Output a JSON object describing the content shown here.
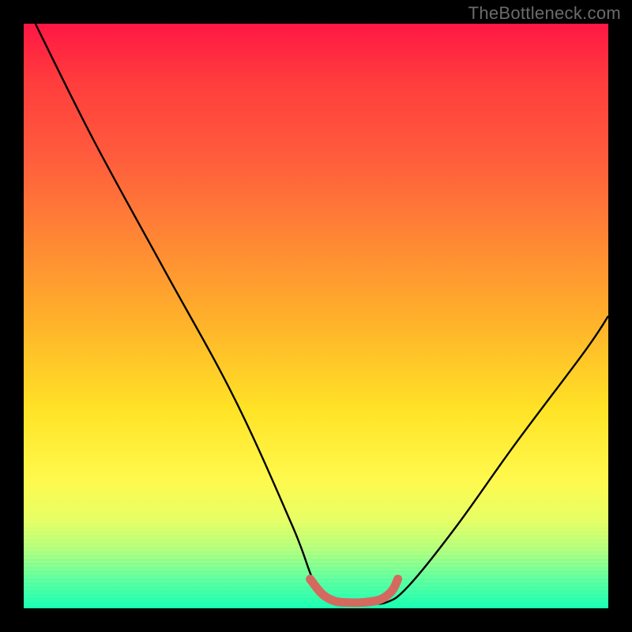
{
  "watermark": {
    "text": "TheBottleneck.com"
  },
  "chart_data": {
    "type": "line",
    "title": "",
    "xlabel": "",
    "ylabel": "",
    "xlim": [
      0,
      100
    ],
    "ylim": [
      0,
      100
    ],
    "grid": false,
    "legend_position": "none",
    "note": "Values are relative percentages read off the plot area (0 = bottom/left, 100 = top/right).",
    "series": [
      {
        "name": "bottleneck-curve",
        "x": [
          2,
          12,
          24,
          36,
          46,
          50,
          54,
          58,
          62,
          66,
          74,
          84,
          96,
          100
        ],
        "y": [
          100,
          80,
          58,
          36,
          14,
          4,
          1,
          1,
          1,
          4,
          14,
          28,
          44,
          50
        ]
      },
      {
        "name": "highlight-segment",
        "x": [
          49,
          51,
          53,
          55,
          58,
          61,
          63,
          64
        ],
        "y": [
          5,
          2.5,
          1.3,
          1,
          1,
          1.5,
          3,
          5
        ]
      }
    ],
    "colors": {
      "curve": "#000000",
      "highlight": "#d46a5f",
      "gradient_top": "#ff1744",
      "gradient_bottom": "#19ffb5"
    }
  }
}
